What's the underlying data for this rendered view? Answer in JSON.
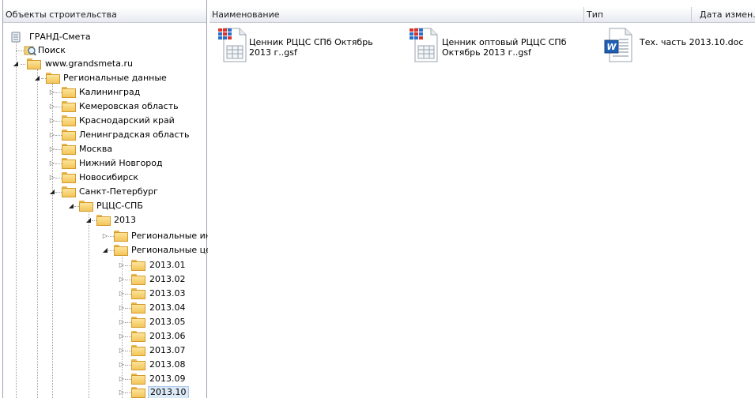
{
  "tree": {
    "header": "Объекты строительства",
    "items": [
      {
        "label": "ГРАНД-Смета",
        "icon": "database-icon"
      },
      {
        "label": "Поиск",
        "icon": "search-icon"
      },
      {
        "label": "www.grandsmeta.ru",
        "icon": "folder-icon"
      },
      {
        "label": "Региональные данные",
        "icon": "folder-icon"
      },
      {
        "label": "Калининград",
        "icon": "folder-icon"
      },
      {
        "label": "Кемеровская область",
        "icon": "folder-icon"
      },
      {
        "label": "Краснодарский край",
        "icon": "folder-icon"
      },
      {
        "label": "Ленинградская область",
        "icon": "folder-icon"
      },
      {
        "label": "Москва",
        "icon": "folder-icon"
      },
      {
        "label": "Нижний Новгород",
        "icon": "folder-icon"
      },
      {
        "label": "Новосибирск",
        "icon": "folder-icon"
      },
      {
        "label": "Санкт-Петербург",
        "icon": "folder-icon"
      },
      {
        "label": "РЦЦС-СПБ",
        "icon": "folder-icon"
      },
      {
        "label": "2013",
        "icon": "folder-icon"
      },
      {
        "label": "Региональные ин",
        "icon": "folder-icon"
      },
      {
        "label": "Региональные це",
        "icon": "folder-icon"
      },
      {
        "label": "2013.01",
        "icon": "folder-icon"
      },
      {
        "label": "2013.02",
        "icon": "folder-icon"
      },
      {
        "label": "2013.03",
        "icon": "folder-icon"
      },
      {
        "label": "2013.04",
        "icon": "folder-icon"
      },
      {
        "label": "2013.05",
        "icon": "folder-icon"
      },
      {
        "label": "2013.06",
        "icon": "folder-icon"
      },
      {
        "label": "2013.07",
        "icon": "folder-icon"
      },
      {
        "label": "2013.08",
        "icon": "folder-icon"
      },
      {
        "label": "2013.09",
        "icon": "folder-icon"
      },
      {
        "label": "2013.10",
        "icon": "folder-icon",
        "selected": true
      }
    ]
  },
  "list": {
    "columns": {
      "name": "Наименование",
      "type": "Тип",
      "date": "Дата измен."
    },
    "files": [
      {
        "name_line1": "Ценник РЦЦС СПб Октябрь",
        "name_line2": "2013 г..gsf",
        "icon": "spreadsheet-icon"
      },
      {
        "name_line1": "Ценник оптовый РЦЦС СПб",
        "name_line2": "Октябрь 2013 г..gsf",
        "icon": "spreadsheet-icon"
      },
      {
        "name_line1": "Тех. часть 2013.10.doc",
        "name_line2": "",
        "icon": "word-doc-icon"
      }
    ]
  },
  "colors": {
    "folder": "#f3c55a",
    "header_bg": "#e6eaf0",
    "selection": "#dbe8f6"
  }
}
